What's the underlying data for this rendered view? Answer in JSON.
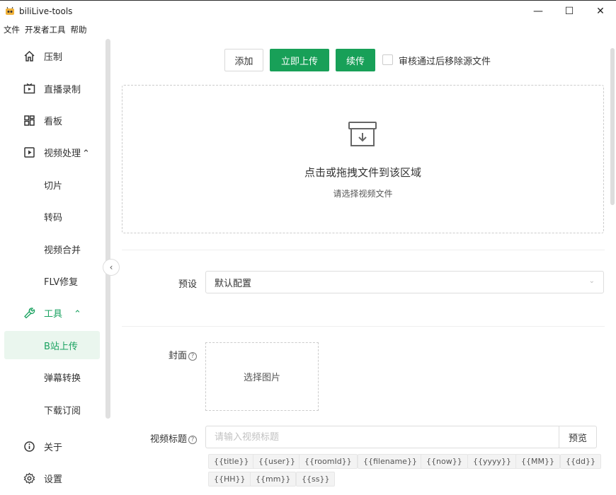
{
  "window": {
    "title": "biliLive-tools",
    "minimize": "—",
    "maximize": "☐",
    "close": "✕"
  },
  "menu": [
    "文件",
    "开发者工具",
    "帮助"
  ],
  "sidebar": {
    "items": [
      {
        "label": "压制",
        "icon": "home-icon"
      },
      {
        "label": "直播录制",
        "icon": "tv-icon"
      },
      {
        "label": "看板",
        "icon": "dashboard-icon"
      },
      {
        "label": "视频处理",
        "icon": "play-square-icon",
        "suffix": "^"
      },
      {
        "label": "切片"
      },
      {
        "label": "转码"
      },
      {
        "label": "视频合并"
      },
      {
        "label": "FLV修复"
      },
      {
        "label": "工具",
        "icon": "wrench-icon",
        "suffix": "^"
      },
      {
        "label": "B站上传",
        "active": true
      },
      {
        "label": "弹幕转换"
      },
      {
        "label": "下载订阅"
      },
      {
        "label": "关于",
        "icon": "info-icon"
      },
      {
        "label": "设置",
        "icon": "gear-icon"
      }
    ],
    "collapse_glyph": "‹"
  },
  "toolbar": {
    "add_label": "添加",
    "upload_now_label": "立即上传",
    "continue_label": "续传",
    "remove_source_label": "审核通过后移除源文件",
    "remove_source_checked": false
  },
  "dropzone": {
    "title": "点击或拖拽文件到该区域",
    "subtitle": "请选择视频文件"
  },
  "form": {
    "preset_label": "预设",
    "preset_value": "默认配置",
    "cover_label": "封面",
    "cover_button": "选择图片",
    "video_title_label": "视频标题",
    "video_title_placeholder": "请输入视频标题",
    "video_title_value": "",
    "preview_label": "预览",
    "help_glyph": "?",
    "tags": [
      "{{title}}",
      "{{user}}",
      "{{roomId}}",
      "{{filename}}",
      "{{now}}",
      "{{yyyy}}",
      "{{MM}}",
      "{{dd}}",
      "{{HH}}",
      "{{mm}}",
      "{{ss}}"
    ]
  },
  "colors": {
    "primary": "#18a058",
    "active_bg": "#eaf6ee"
  }
}
